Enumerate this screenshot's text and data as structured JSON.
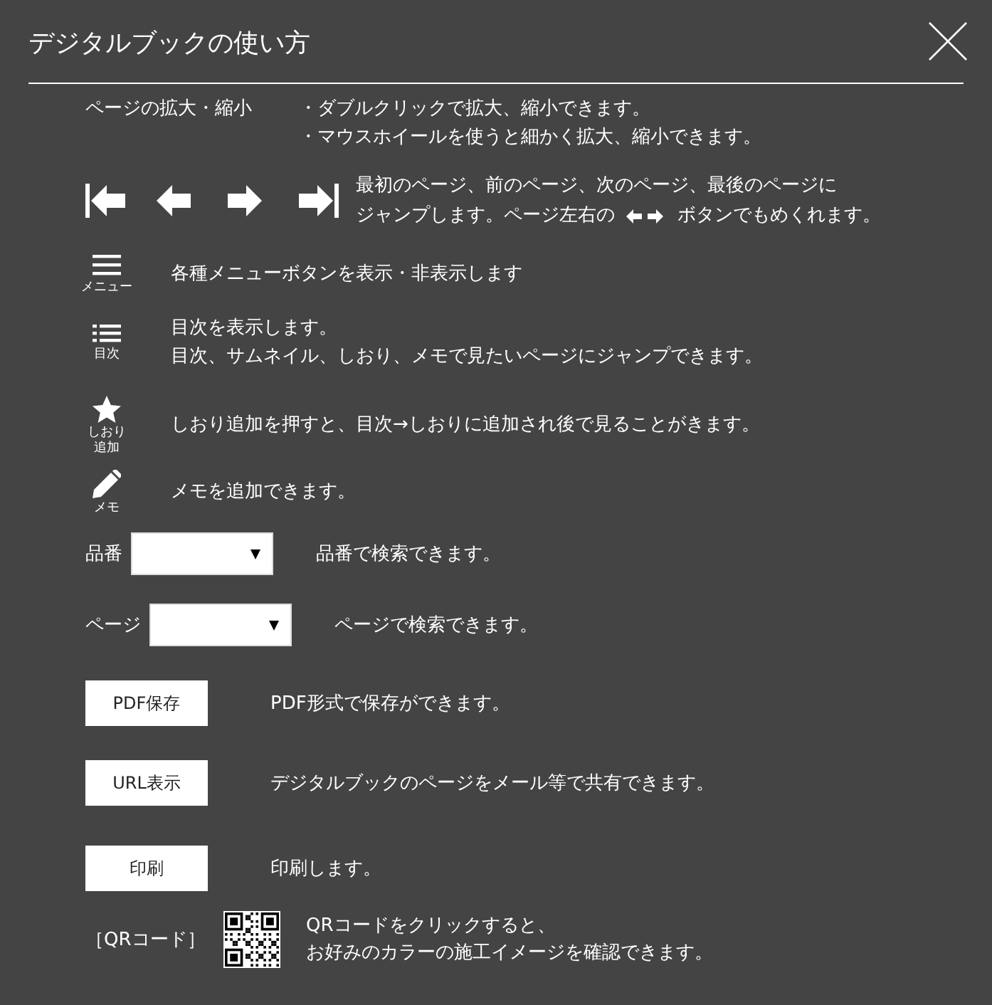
{
  "dialog": {
    "title": "デジタルブックの使い方"
  },
  "zoom": {
    "label": "ページの拡大・縮小",
    "lines": [
      "・ダブルクリックで拡大、縮小できます。",
      "・マウスホイールを使うと細かく拡大、縮小できます。"
    ]
  },
  "navigation": {
    "line_1": "最初のページ、前のページ、次のページ、最後のページに",
    "line_2_before": "ジャンプします。ページ左右の",
    "line_2_after": "ボタンでもめくれます。"
  },
  "tools": [
    {
      "kind": "menu",
      "caption": "メニュー",
      "lines": [
        "各種メニューボタンを表示・非表示します"
      ]
    },
    {
      "kind": "toc",
      "caption": "目次",
      "lines": [
        "目次を表示します。",
        "目次、サムネイル、しおり、メモで見たいページにジャンプできます。"
      ]
    },
    {
      "kind": "bookmark",
      "caption": "しおり追加",
      "lines": [
        "しおり追加を押すと、目次→しおりに追加され後で見ることがきます。"
      ]
    },
    {
      "kind": "memo",
      "caption": "メモ",
      "lines": [
        "メモを追加できます。"
      ]
    }
  ],
  "searches": [
    {
      "label": "品番",
      "description": "品番で検索できます。"
    },
    {
      "label": "ページ",
      "description": "ページで検索できます。"
    }
  ],
  "actions": [
    {
      "label": "PDF保存",
      "description": "PDF形式で保存ができます。"
    },
    {
      "label": "URL表示",
      "description": "デジタルブックのページをメール等で共有できます。"
    },
    {
      "label": "印刷",
      "description": "印刷します。"
    }
  ],
  "qr": {
    "label": "［QRコード］",
    "lines": [
      "QRコードをクリックすると、",
      "お好みのカラーの施工イメージを確認できます。"
    ]
  }
}
